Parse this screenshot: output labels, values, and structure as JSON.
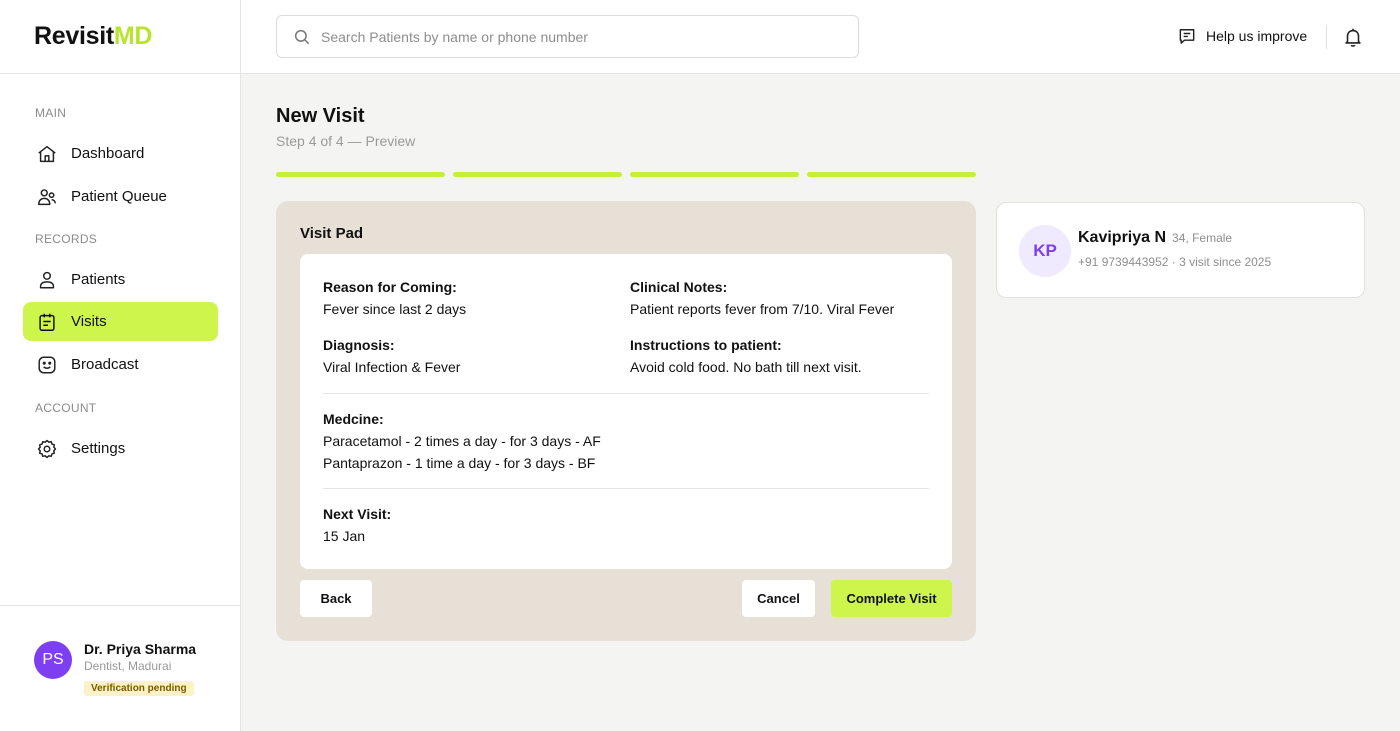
{
  "app": {
    "logo_main": "Revisit",
    "logo_accent": "MD"
  },
  "search": {
    "placeholder": "Search Patients by name or phone number"
  },
  "header": {
    "help_label": "Help us improve"
  },
  "sidebar": {
    "sections": {
      "main": "MAIN",
      "records": "RECORDS",
      "account": "ACCOUNT"
    },
    "items": [
      {
        "label": "Dashboard",
        "icon": "home-icon"
      },
      {
        "label": "Patient Queue",
        "icon": "users-icon"
      },
      {
        "label": "Patients",
        "icon": "user-icon"
      },
      {
        "label": "Visits",
        "icon": "clipboard-icon",
        "active": true
      },
      {
        "label": "Broadcast",
        "icon": "smile-icon"
      },
      {
        "label": "Settings",
        "icon": "gear-icon"
      }
    ],
    "user": {
      "initials": "PS",
      "name": "Dr. Priya Sharma",
      "role": "Dentist, Madurai",
      "badge": "Verification pending"
    }
  },
  "page": {
    "title": "New Visit",
    "subtitle": "Step 4 of 4 — Preview",
    "progress": {
      "current_step": 4,
      "total_steps": 4
    }
  },
  "visit_pad": {
    "title": "Visit Pad",
    "reason_label": "Reason for Coming:",
    "reason_value": "Fever since last 2 days",
    "notes_label": "Clinical Notes:",
    "notes_value": "Patient reports fever from 7/10. Viral Fever",
    "diagnosis_label": "Diagnosis:",
    "diagnosis_value": "Viral Infection & Fever",
    "instructions_label": "Instructions to patient:",
    "instructions_value": "Avoid cold food. No bath till next visit.",
    "medicine_label": "Medcine:",
    "medicines": [
      "Paracetamol - 2 times a day - for 3 days - AF",
      "Pantaprazon - 1 time a day - for 3 days - BF"
    ],
    "next_visit_label": "Next Visit:",
    "next_visit_value": "15 Jan",
    "buttons": {
      "back": "Back",
      "cancel": "Cancel",
      "complete": "Complete Visit"
    }
  },
  "patient": {
    "initials": "KP",
    "name": "Kavipriya N",
    "meta": "34, Female",
    "contact": "+91 9739443952 · 3 visit since 2025"
  },
  "colors": {
    "accent": "#cdf54b",
    "progress": "#c5ef3a",
    "avatar_purple": "#7e3ff2",
    "pad_bg": "#e7e0d6"
  }
}
